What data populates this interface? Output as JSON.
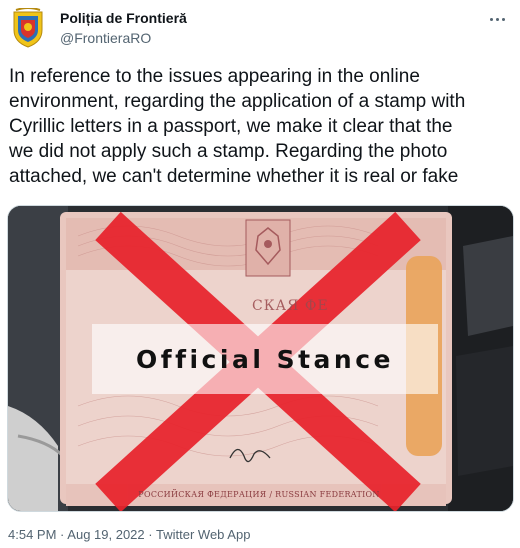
{
  "author": {
    "name": "Poliția de Frontieră",
    "handle": "@FrontieraRO"
  },
  "icons": {
    "avatar": "romanian-border-police-crest-icon",
    "more": "more-options-icon"
  },
  "tweet": {
    "text": "In reference to the issues appearing in the online\nenvironment, regarding the application of a stamp with\nCyrillic letters in a passport, we make it clear that the\nwe did not apply such a stamp. Regarding the photo\nattached, we can't determine whether it is real or fake"
  },
  "media": {
    "overlay_text": "Official Stance",
    "passport_header_text": "СКАЯ ФЕ",
    "passport_footer_text": "РОССИЙСКАЯ ФЕДЕРАЦИЯ / RUSSIAN FEDERATION"
  },
  "meta": {
    "time": "4:54 PM",
    "separator": "·",
    "date": "Aug 19, 2022",
    "source": "Twitter Web App"
  },
  "colors": {
    "text": "#0f1419",
    "secondary": "#536471",
    "cross": "#e8232c"
  }
}
